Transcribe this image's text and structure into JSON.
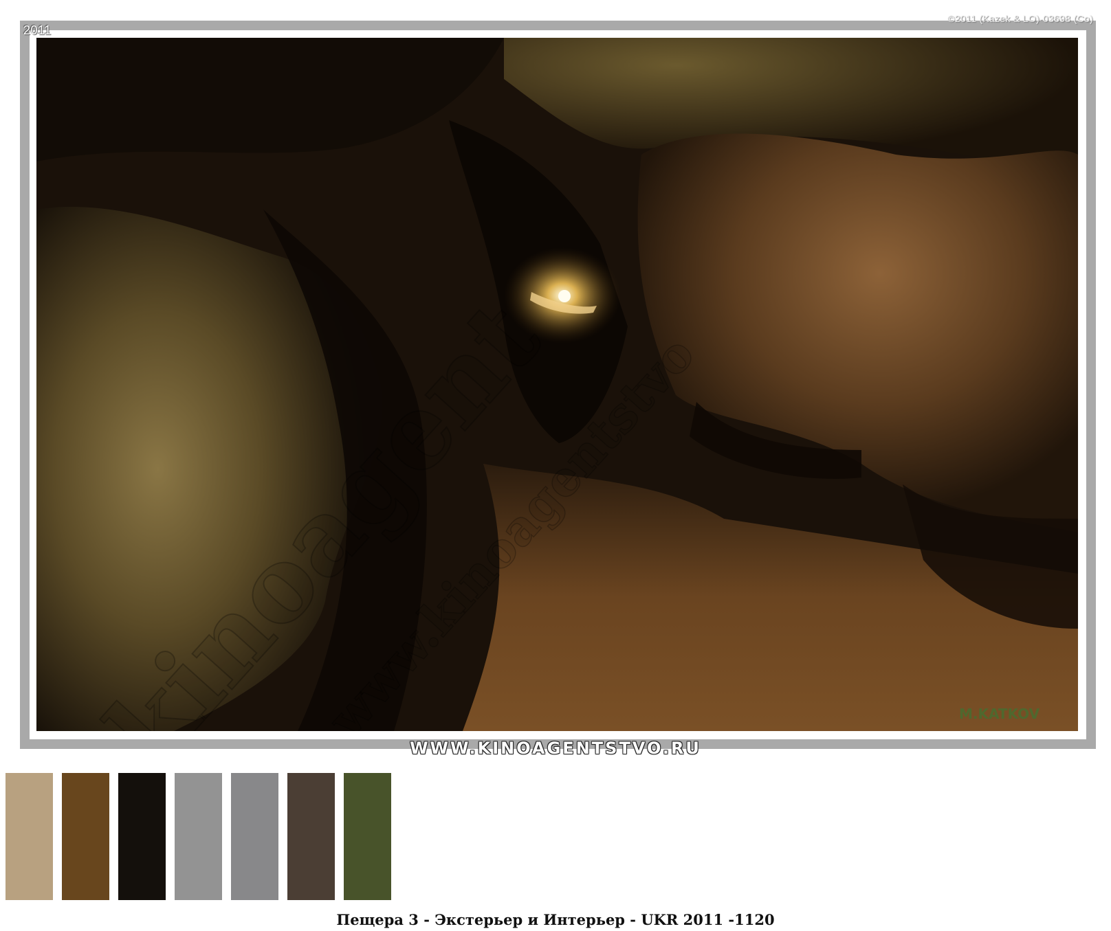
{
  "photo": {
    "year_label": "2011",
    "copyright": "©2011 (Kazek & LO)-03698 (Co)",
    "signature": "M.KATKOV",
    "watermark_big": "kinoagent",
    "watermark_small": "www.kinoagentstvo"
  },
  "site_banner": "WWW.KINOAGENTSTVO.RU",
  "palette": {
    "swatches": [
      {
        "color": "#b8a180"
      },
      {
        "color": "#68461d"
      },
      {
        "color": "#14100c"
      },
      {
        "color": "#939393"
      },
      {
        "color": "#88888a"
      },
      {
        "color": "#4b3e34"
      },
      {
        "color": "#48532a"
      }
    ]
  },
  "caption": "Пещера 3 - Экстерьер и Интерьер - UKR 2011 -1120"
}
